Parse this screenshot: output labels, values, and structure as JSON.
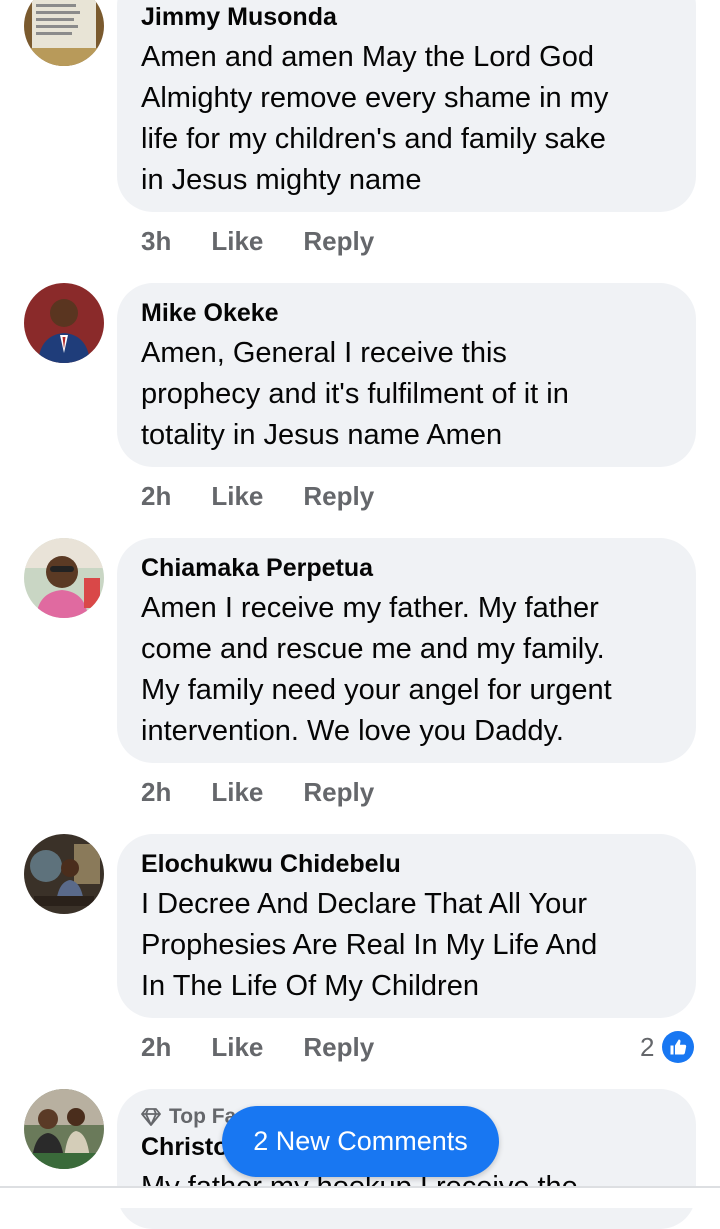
{
  "comments": [
    {
      "name": "Jimmy Musonda",
      "text": "Amen and amen May the Lord God\nAlmighty remove every shame in my\nlife for my children's and family sake\nin Jesus mighty name",
      "time": "3h",
      "like": "Like",
      "reply": "Reply"
    },
    {
      "name": "Mike Okeke",
      "text": "Amen, General I receive this\nprophecy and it's fulfilment of it in\ntotality in Jesus name Amen",
      "time": "2h",
      "like": "Like",
      "reply": "Reply"
    },
    {
      "name": "Chiamaka Perpetua",
      "text": "Amen I receive my father. My father\ncome and rescue me and my family.\nMy family need your angel for urgent\nintervention. We love you Daddy.",
      "time": "2h",
      "like": "Like",
      "reply": "Reply"
    },
    {
      "name": "Elochukwu Chidebelu",
      "text": "I Decree And Declare That All Your\nProphesies Are Real In My Life And\nIn The Life Of My Children",
      "time": "2h",
      "like": "Like",
      "reply": "Reply",
      "reaction_count": "2",
      "reaction_icon": "thumbs-up-icon"
    },
    {
      "badge": "Top Fa",
      "badge_icon": "diamond-icon",
      "name": "Christo",
      "text": "My father my hookup I receive the"
    }
  ],
  "new_comments_button": "2 New Comments",
  "colors": {
    "bubble": "#f0f2f5",
    "secondary_text": "#65676b",
    "accent": "#1877f2"
  }
}
